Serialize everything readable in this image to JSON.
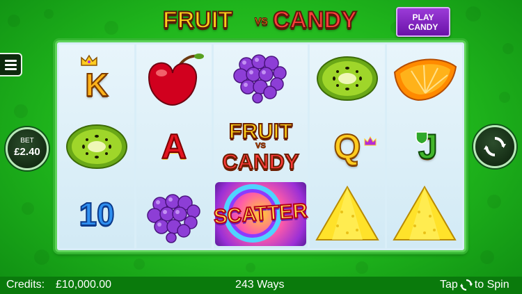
{
  "logo": {
    "word1": "FRUIT",
    "vs": "VS",
    "word2": "CANDY"
  },
  "play_candy": {
    "line1": "PLAY",
    "line2": "CANDY"
  },
  "bet": {
    "label": "BET",
    "value": "£2.40"
  },
  "reels": [
    [
      {
        "symbol": "king-k",
        "text": "K"
      },
      {
        "symbol": "kiwi"
      },
      {
        "symbol": "ten",
        "text": "10"
      }
    ],
    [
      {
        "symbol": "cherry"
      },
      {
        "symbol": "ace",
        "text": "A"
      },
      {
        "symbol": "grapes"
      }
    ],
    [
      {
        "symbol": "grapes"
      },
      {
        "symbol": "wild-logo",
        "text1": "FRUIT",
        "text2": "VS",
        "text3": "CANDY"
      },
      {
        "symbol": "scatter",
        "text": "SCATTER"
      }
    ],
    [
      {
        "symbol": "kiwi"
      },
      {
        "symbol": "queen-q",
        "text": "Q"
      },
      {
        "symbol": "pineapple"
      }
    ],
    [
      {
        "symbol": "orange"
      },
      {
        "symbol": "jack-j",
        "text": "J"
      },
      {
        "symbol": "pineapple"
      }
    ]
  ],
  "bottom_bar": {
    "credits_label": "Credits:",
    "credits_value": "£10,000.00",
    "ways": "243 Ways",
    "tap_label": "Tap",
    "to_spin_label": "to Spin"
  },
  "colors": {
    "background_green": "#1fb51c",
    "bottom_bar": "#0a7a0c",
    "play_candy_purple": "#7a1fb8",
    "reel_panel": "#d9eef8"
  }
}
